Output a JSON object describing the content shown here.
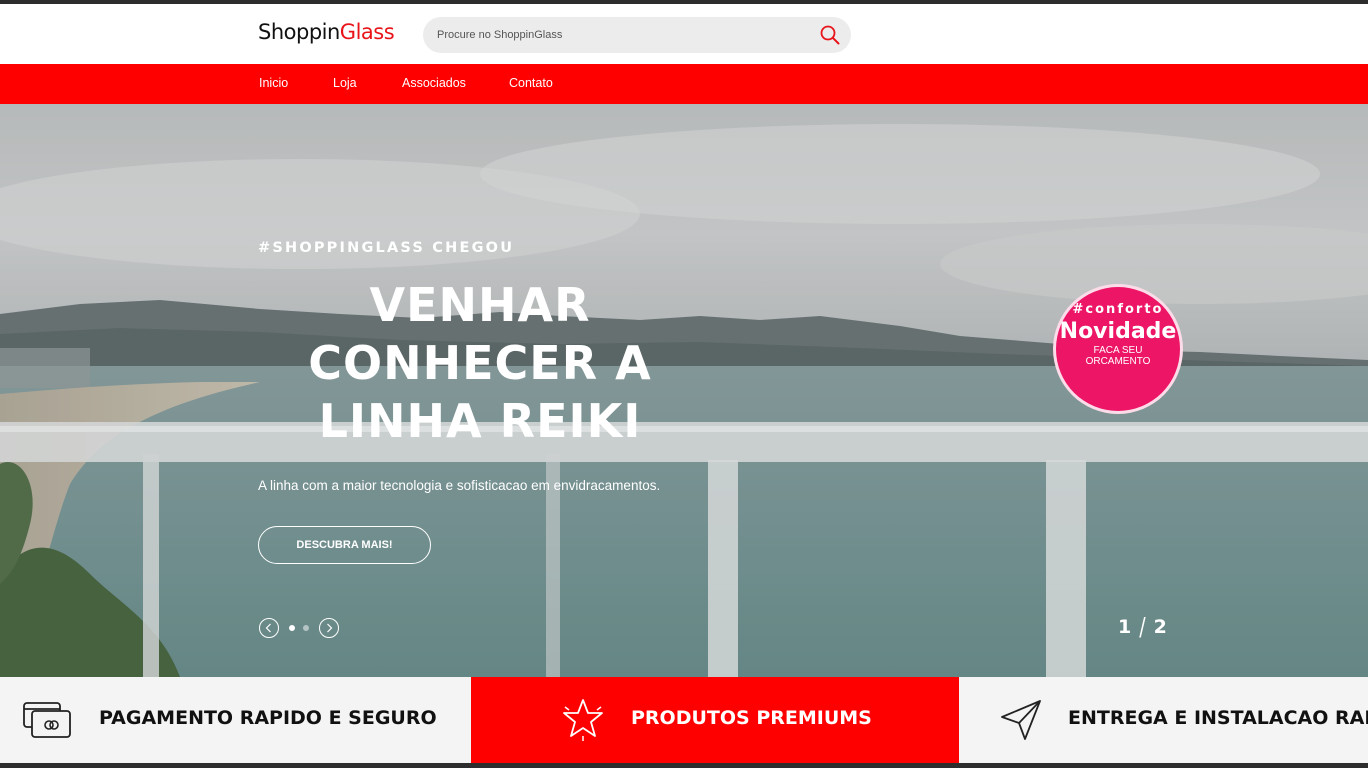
{
  "header": {
    "logo_part1": "Shoppin",
    "logo_part2": "Glass",
    "search_placeholder": "Procure no ShoppinGlass"
  },
  "nav": {
    "items": [
      {
        "label": "Inicio"
      },
      {
        "label": "Loja"
      },
      {
        "label": "Associados"
      },
      {
        "label": "Contato"
      }
    ]
  },
  "hero": {
    "eyebrow": "#SHOPPINGLASS CHEGOU",
    "headline_line1": "VENHAR",
    "headline_line2": "CONHECER A",
    "headline_line3": "LINHA REIKI",
    "subtitle": "A linha com a maior tecnologia e sofisticacao em envidracamentos.",
    "cta_label": "DESCUBRA MAIS!",
    "counter_current": "1",
    "counter_separator": "/",
    "counter_total": "2",
    "active_slide": 1,
    "slide_count": 2
  },
  "badge": {
    "tag": "#conforto",
    "title": "Novidade",
    "text": "FACA SEU ORCAMENTO"
  },
  "features": [
    {
      "label": "PAGAMENTO RAPIDO E SEGURO",
      "icon": "credit-card-icon"
    },
    {
      "label": "PRODUTOS PREMIUMS",
      "icon": "star-icon"
    },
    {
      "label": "ENTREGA E INSTALACAO RAPIDA",
      "icon": "paper-plane-icon"
    }
  ],
  "colors": {
    "brand_red": "#ff0000",
    "logo_red": "#e8141a",
    "badge_pink": "#ec1566",
    "text_dark": "#111111"
  }
}
